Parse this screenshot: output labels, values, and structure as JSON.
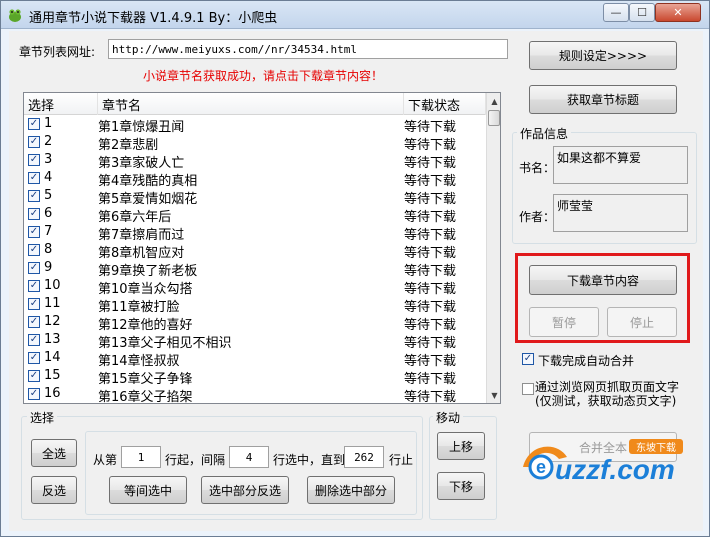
{
  "window": {
    "title": "通用章节小说下载器 V1.4.9.1 By：小爬虫",
    "min_glyph": "—",
    "max_glyph": "☐",
    "close_glyph": "✕"
  },
  "url_row": {
    "label": "章节列表网址:",
    "value": "http://www.meiyuxs.com//nr/34534.html"
  },
  "status_message": "小说章节名获取成功，请点击下载章节内容！",
  "colors": {
    "status_message": "#e60000",
    "highlight": "#e0191b"
  },
  "chapter_list": {
    "columns": [
      "选择",
      "章节名",
      "下载状态"
    ],
    "rows": [
      {
        "num": "1",
        "name": "第1章惊爆丑闻",
        "status": "等待下载"
      },
      {
        "num": "2",
        "name": "第2章悲剧",
        "status": "等待下载"
      },
      {
        "num": "3",
        "name": "第3章家破人亡",
        "status": "等待下载"
      },
      {
        "num": "4",
        "name": "第4章残酷的真相",
        "status": "等待下载"
      },
      {
        "num": "5",
        "name": "第5章爱情如烟花",
        "status": "等待下载"
      },
      {
        "num": "6",
        "name": "第6章六年后",
        "status": "等待下载"
      },
      {
        "num": "7",
        "name": "第7章擦肩而过",
        "status": "等待下载"
      },
      {
        "num": "8",
        "name": "第8章机智应对",
        "status": "等待下载"
      },
      {
        "num": "9",
        "name": "第9章换了新老板",
        "status": "等待下载"
      },
      {
        "num": "10",
        "name": "第10章当众勾搭",
        "status": "等待下载"
      },
      {
        "num": "11",
        "name": "第11章被打脸",
        "status": "等待下载"
      },
      {
        "num": "12",
        "name": "第12章他的喜好",
        "status": "等待下载"
      },
      {
        "num": "13",
        "name": "第13章父子相见不相识",
        "status": "等待下载"
      },
      {
        "num": "14",
        "name": "第14章怪叔叔",
        "status": "等待下载"
      },
      {
        "num": "15",
        "name": "第15章父子争锋",
        "status": "等待下载"
      },
      {
        "num": "16",
        "name": "第16章父子掐架",
        "status": "等待下载"
      }
    ]
  },
  "right_panel": {
    "rules_button": "规则设定>>>>",
    "get_titles_button": "获取章节标题",
    "work_info_title": "作品信息",
    "book_name_label": "书名：",
    "book_name_value": "如果这都不算爱",
    "author_label": "作者：",
    "author_value": "师莹莹",
    "download_button": "下载章节内容",
    "pause_button": "暂停",
    "stop_button": "停止",
    "auto_merge_label": "下载完成自动合并",
    "auto_merge_checked": true,
    "browser_fetch_label_1": "通过浏览网页抓取页面文字",
    "browser_fetch_label_2": "(仅测试，获取动态页文字)",
    "browser_fetch_checked": false,
    "merge_all_button": "合并全本"
  },
  "selection_group": {
    "title": "选择",
    "select_all": "全选",
    "invert": "反选",
    "from_label": "从第",
    "from_value": "1",
    "row_start_label": "行起，间隔",
    "interval_value": "4",
    "row_select_label": "行选中，直到",
    "to_value": "262",
    "row_stop_label": "行止",
    "interval_select_button": "等间选中",
    "invert_partial_button": "选中部分反选",
    "delete_selected_button": "删除选中部分"
  },
  "move_group": {
    "title": "移动",
    "up_button": "上移",
    "down_button": "下移"
  },
  "watermark": {
    "main_text": "uzzf.com",
    "badge_text": "东坡下载"
  }
}
